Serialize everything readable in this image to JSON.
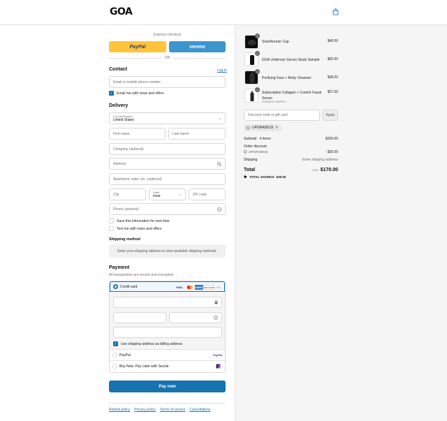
{
  "header": {
    "logo": "GOA",
    "cart_icon": "shopping-bag-icon"
  },
  "express": {
    "label": "Express checkout",
    "paypal_label": "PayPal",
    "venmo_label": "venmo",
    "or_label": "OR"
  },
  "contact": {
    "title": "Contact",
    "login_label": "Log in",
    "email_placeholder": "Email or mobile phone number",
    "news_label": "Email me with news and offers",
    "news_checked": true
  },
  "delivery": {
    "title": "Delivery",
    "country_label": "Country/Region",
    "country_value": "United States",
    "first_name_placeholder": "First name",
    "last_name_placeholder": "Last name",
    "company_placeholder": "Company (optional)",
    "address_placeholder": "Address",
    "apartment_placeholder": "Apartment, suite, etc. (optional)",
    "city_placeholder": "City",
    "state_label": "State",
    "state_value": "Iowa",
    "zip_placeholder": "ZIP code",
    "phone_placeholder": "Phone (optional)",
    "save_info_label": "Save this information for next time",
    "text_news_label": "Text me with news and offers"
  },
  "shipping": {
    "title": "Shipping method",
    "message": "Enter your shipping address to view available shipping methods."
  },
  "payment": {
    "title": "Payment",
    "subtitle": "All transactions are secure and encrypted.",
    "credit_card_label": "Credit card",
    "card_brands": [
      "VISA",
      "MC",
      "AMEX",
      "DISCOVER"
    ],
    "more_brands": "+2",
    "billing_label": "Use shipping address as billing address",
    "paypal_label": "PayPal",
    "paypal_logo": "PayPal",
    "sezzle_label": "Buy Now, Pay Later with Sezzle"
  },
  "pay_now_label": "Pay now",
  "footer": {
    "links": [
      "Refund policy",
      "Privacy policy",
      "Terms of service",
      "Cancellations"
    ]
  },
  "order": {
    "items": [
      {
        "name": "SolarRunner Cap",
        "price": "$40.00",
        "qty": "1",
        "subtitle": ""
      },
      {
        "name": "GOA Undereye Serum Study Sample",
        "price": "$65.00",
        "qty": "1",
        "subtitle": ""
      },
      {
        "name": "Purifying Face + Body Cleanser",
        "price": "$38.00",
        "qty": "1",
        "subtitle": ""
      },
      {
        "name": "Subscription Collagen + Control Facial Serum",
        "price": "$57.00",
        "qty": "1",
        "subtitle": "3-MONTH SUPPLY"
      }
    ],
    "discount_placeholder": "Discount code or gift card",
    "apply_label": "Apply",
    "applied_code": "UPGRADE15",
    "subtotal_label": "Subtotal · 4 items",
    "subtotal_value": "$200.00",
    "order_discount_label": "Order discount",
    "discount_code": "UPGRADE15",
    "discount_value": "- $30.00",
    "shipping_label": "Shipping",
    "shipping_value": "Enter shipping address",
    "total_label": "Total",
    "currency": "USD",
    "total_value": "$170.00",
    "savings_label": "TOTAL SAVINGS",
    "savings_value": "$30.00"
  }
}
